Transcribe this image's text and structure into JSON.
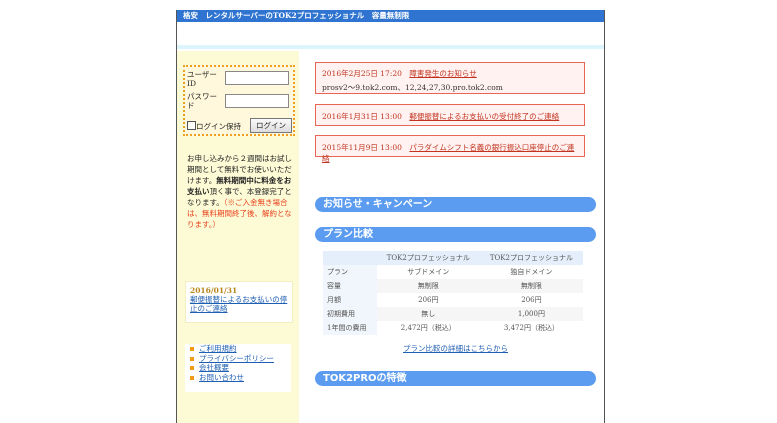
{
  "header": {
    "title": "格安　レンタルサーバーのTOK2プロフェッショナル　容量無制限"
  },
  "login": {
    "user_label": "ユーザーID",
    "password_label": "パスワード",
    "keep_label": "ログイン保持",
    "login_button": "ログイン"
  },
  "intro": {
    "line1": "お申し込みから２週間はお試し期間として無料でお使いいただけます。",
    "bold": "無料期間中に料金をお支払い",
    "line2": "頂く事で、本登録完了となります。",
    "warn": "（※ご入金無き場合は、無料期間終了後、解約となります。）"
  },
  "side_news": {
    "date": "2016/01/31",
    "link": "郵便振替によるお支払いの停止のご連絡"
  },
  "side_links": [
    "ご利用規約",
    "プライバシーポリシー",
    "会社概要",
    "お問い合わせ"
  ],
  "notices": [
    {
      "date": "2016年2月25日 17:20",
      "title": "障害発生のお知らせ",
      "sub": "prosv2～9.tok2.com、12,24,27,30.pro.tok2.com"
    },
    {
      "date": "2016年1月31日 13:00",
      "title": "郵便振替によるお支払いの受付終了のご連絡",
      "sub": ""
    },
    {
      "date": "2015年11月9日 13:00",
      "title": "パラダイムシフト名義の銀行振込口座停止のご連絡",
      "sub": ""
    }
  ],
  "sections": {
    "news": "お知らせ・キャンペーン",
    "compare": "プラン比較",
    "features": "TOK2PROの特徴"
  },
  "plan_table": {
    "headers": [
      "",
      "TOK2プロフェッショナル",
      "TOK2プロフェッショナル"
    ],
    "rows": [
      [
        "プラン",
        "サブドメイン",
        "独自ドメイン"
      ],
      [
        "容量",
        "無制限",
        "無制限"
      ],
      [
        "月額",
        "206円",
        "206円"
      ],
      [
        "初期費用",
        "無し",
        "1,000円"
      ],
      [
        "1年間の費用",
        "2,472円（税込）",
        "3,472円（税込）"
      ]
    ],
    "detail_link": "プラン比較の詳細はこちらから"
  }
}
